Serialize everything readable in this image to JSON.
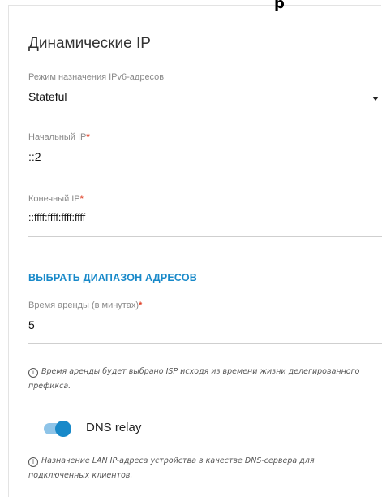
{
  "header_fragment": "р",
  "section_title": "Динамические IP",
  "ipv6_mode": {
    "label": "Режим назначения IPv6-адресов",
    "value": "Stateful"
  },
  "start_ip": {
    "label": "Начальный IP",
    "required_mark": "*",
    "value": "::2"
  },
  "end_ip": {
    "label": "Конечный IP",
    "required_mark": "*",
    "value": "::ffff:ffff:ffff:ffff"
  },
  "select_range_link": "ВЫБРАТЬ ДИАПАЗОН АДРЕСОВ",
  "lease_time": {
    "label": "Время аренды (в минутах)",
    "required_mark": "*",
    "value": "5"
  },
  "lease_hint": "Время аренды будет выбрано ISP исходя из времени жизни делегированного префикса.",
  "dns_relay": {
    "label": "DNS relay",
    "enabled": true,
    "hint": "Назначение LAN IP-адреса устройства в качестве DNS-сервера для подключенных клиентов."
  },
  "colors": {
    "accent": "#1889c9",
    "required": "#e0442b",
    "toggle_track": "#8ec4e8"
  },
  "icons": {
    "info": "info-circle-icon",
    "dropdown": "caret-down-icon"
  }
}
